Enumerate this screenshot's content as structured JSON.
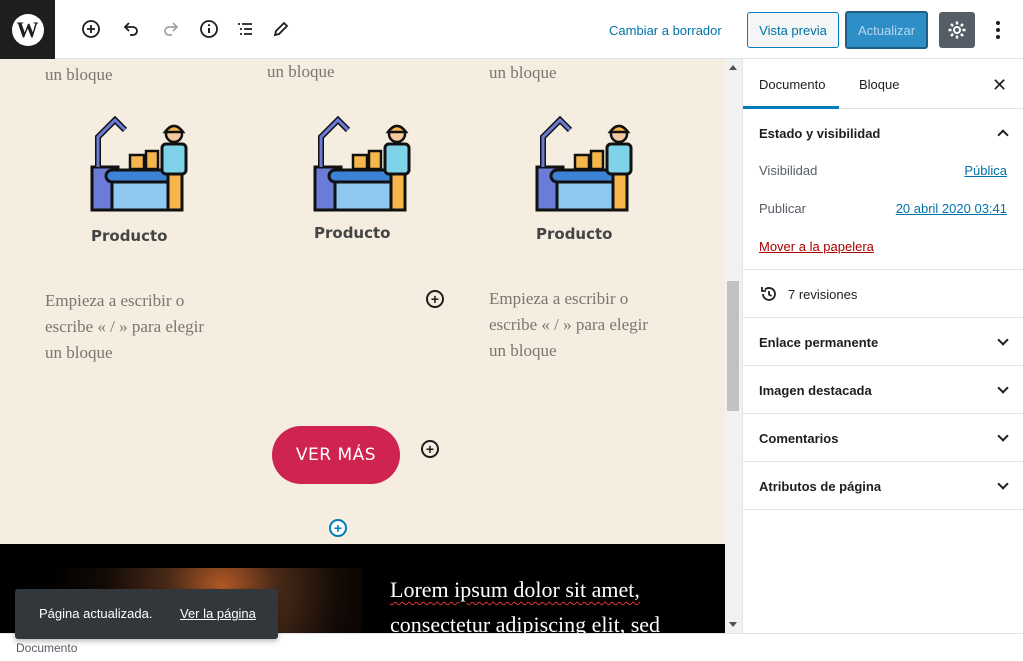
{
  "toolbar": {
    "logo_letter": "W",
    "draft_label": "Cambiar a borrador",
    "preview_label": "Vista previa",
    "update_label": "Actualizar"
  },
  "canvas": {
    "top_texts": [
      "un bloque",
      "un bloque",
      "un bloque"
    ],
    "products": [
      {
        "label": "Producto"
      },
      {
        "label": "Producto"
      },
      {
        "label": "Producto"
      }
    ],
    "placeholder_lines": [
      "Empieza a escribir o",
      "escribe « / » para elegir",
      "un bloque"
    ],
    "button_label": "VER MÁS",
    "lorem_line1": "Lorem ipsum dolor sit amet,",
    "lorem_line2": "consectetur adipiscing elit, sed"
  },
  "sidebar": {
    "tabs": [
      "Documento",
      "Bloque"
    ],
    "close_glyph": "✕",
    "status_panel": {
      "title": "Estado y visibilidad",
      "visibility_label": "Visibilidad",
      "visibility_value": "Pública",
      "publish_label": "Publicar",
      "publish_value": "20 abril 2020 03:41",
      "trash_label": "Mover a la papelera"
    },
    "revisions_label": "7 revisiones",
    "panels": [
      "Enlace permanente",
      "Imagen destacada",
      "Comentarios",
      "Atributos de página"
    ]
  },
  "snackbar": {
    "message": "Página actualizada.",
    "link": "Ver la página"
  },
  "footer": {
    "breadcrumb": "Documento"
  },
  "colors": {
    "accent": "#007cba",
    "canvas_bg": "#f4ede0",
    "button_red": "#cf2450"
  }
}
